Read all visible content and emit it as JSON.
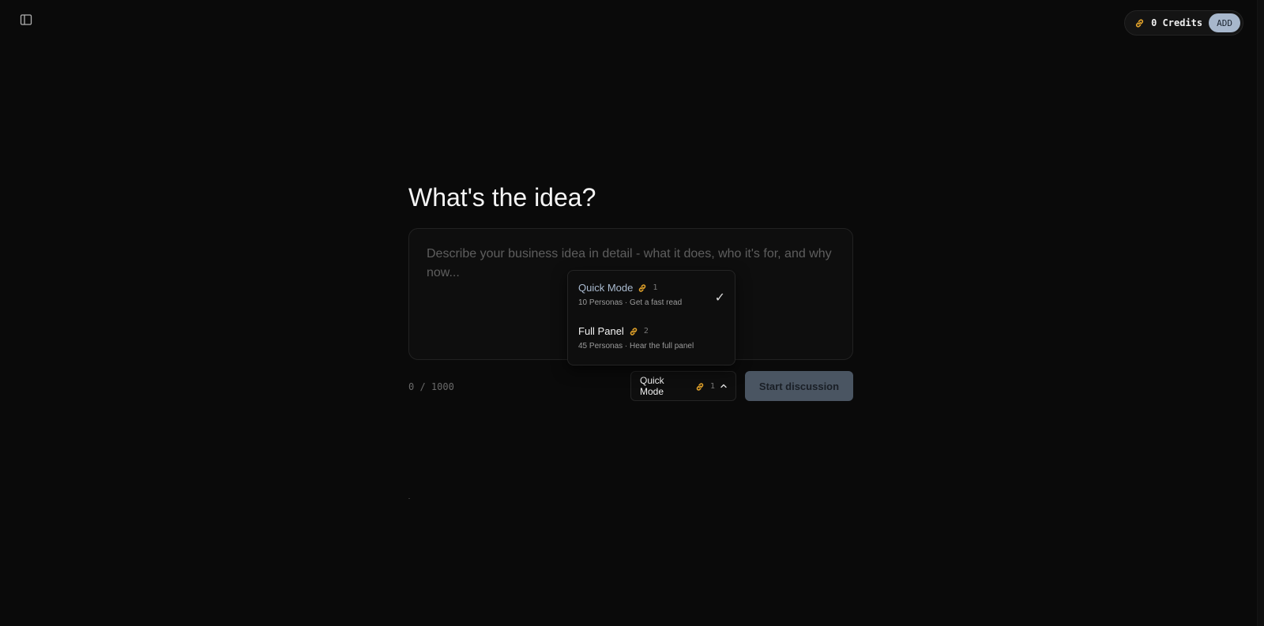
{
  "header": {
    "credits_label": "0 Credits",
    "add_label": "ADD"
  },
  "main": {
    "title": "What's the idea?",
    "idea_placeholder": "Describe your business idea in detail - what it does, who it's for, and why now...",
    "idea_value": "",
    "char_count": "0 / 1000",
    "start_label": "Start discussion"
  },
  "mode_select": {
    "selected_label": "Quick Mode",
    "selected_cost": "1",
    "options": [
      {
        "label": "Quick Mode",
        "cost": "1",
        "description": "10 Personas · Get a fast read",
        "selected": true
      },
      {
        "label": "Full Panel",
        "cost": "2",
        "description": "45 Personas · Hear the full panel",
        "selected": false
      }
    ]
  },
  "icons": {
    "sidebar_toggle": "sidebar-panel-icon",
    "credit": "link-coin-icon",
    "chevron": "chevron-up-icon",
    "check": "check-icon"
  },
  "colors": {
    "background": "#0a0a0a",
    "accent_coin": "#e0a12a",
    "selected_option_text": "#aabbd0",
    "add_button": "#a7b7cc",
    "start_button": "#4a5562"
  }
}
